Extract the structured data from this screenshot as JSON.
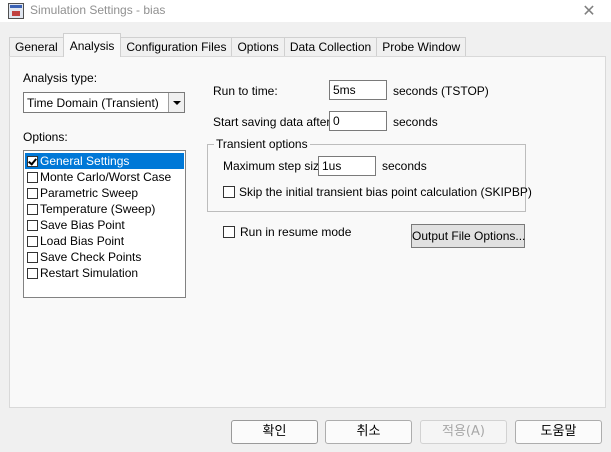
{
  "window": {
    "title": "Simulation Settings - bias",
    "app_icon": "pspice-app-icon",
    "close_glyph": "✕"
  },
  "tabs": [
    {
      "label": "General",
      "active": false
    },
    {
      "label": "Analysis",
      "active": true
    },
    {
      "label": "Configuration Files",
      "active": false
    },
    {
      "label": "Options",
      "active": false
    },
    {
      "label": "Data Collection",
      "active": false
    },
    {
      "label": "Probe Window",
      "active": false
    }
  ],
  "analysis": {
    "type_label": "Analysis type:",
    "type_value": "Time Domain (Transient)",
    "options_label": "Options:",
    "options": [
      {
        "label": "General Settings",
        "checked": true,
        "selected": true
      },
      {
        "label": "Monte Carlo/Worst Case",
        "checked": false,
        "selected": false
      },
      {
        "label": "Parametric Sweep",
        "checked": false,
        "selected": false
      },
      {
        "label": "Temperature (Sweep)",
        "checked": false,
        "selected": false
      },
      {
        "label": "Save Bias Point",
        "checked": false,
        "selected": false
      },
      {
        "label": "Load Bias Point",
        "checked": false,
        "selected": false
      },
      {
        "label": "Save Check Points",
        "checked": false,
        "selected": false
      },
      {
        "label": "Restart Simulation",
        "checked": false,
        "selected": false
      }
    ]
  },
  "settings": {
    "run_to_time_label": "Run to time:",
    "run_to_time_value": "5ms",
    "run_to_time_unit": "seconds  (TSTOP)",
    "start_saving_label": "Start saving data after:",
    "start_saving_value": "0",
    "start_saving_unit": "seconds",
    "transient_group_title": "Transient options",
    "max_step_label": "Maximum step size:",
    "max_step_value": "1us",
    "max_step_unit": "seconds",
    "skip_bias_label": "Skip the initial transient bias point calculation  (SKIPBP)",
    "skip_bias_checked": false,
    "resume_label": "Run in resume mode",
    "resume_checked": false,
    "output_file_button": "Output File Options..."
  },
  "footer": {
    "ok": "확인",
    "cancel": "취소",
    "apply": "적용(A)",
    "help": "도움말"
  }
}
